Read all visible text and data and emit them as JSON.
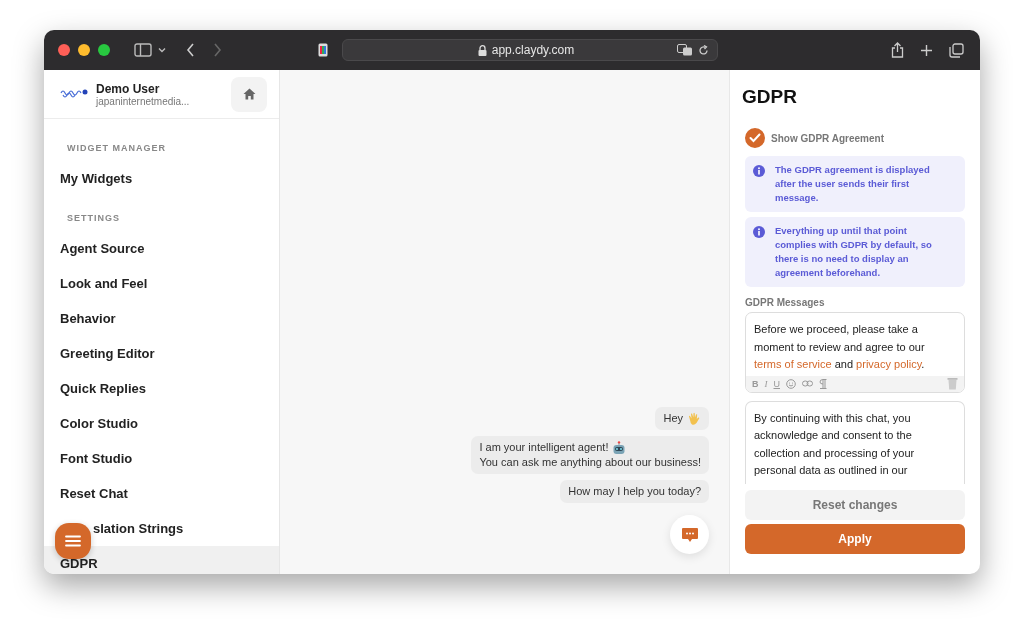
{
  "browser": {
    "url": "app.claydy.com"
  },
  "user": {
    "name": "Demo User",
    "email": "japaninternetmedia..."
  },
  "sidebar": {
    "sections": [
      {
        "heading": "WIDGET MANAGER",
        "items": [
          {
            "label": "My Widgets",
            "selected": false,
            "kind": "plain"
          }
        ]
      },
      {
        "heading": "SETTINGS",
        "items": [
          {
            "label": "Agent Source",
            "selected": false,
            "kind": "plain"
          },
          {
            "label": "Look and Feel",
            "selected": false,
            "kind": "plain"
          },
          {
            "label": "Behavior",
            "selected": false,
            "kind": "plain"
          },
          {
            "label": "Greeting Editor",
            "selected": false,
            "kind": "plain"
          },
          {
            "label": "Quick Replies",
            "selected": false,
            "kind": "plain"
          },
          {
            "label": "Color Studio",
            "selected": false,
            "kind": "plain"
          },
          {
            "label": "Font Studio",
            "selected": false,
            "kind": "plain"
          },
          {
            "label": "Reset Chat",
            "selected": false,
            "kind": "plain"
          },
          {
            "label": "slation Strings",
            "selected": false,
            "kind": "overlapped"
          },
          {
            "label": "GDPR",
            "selected": true,
            "kind": "plain"
          }
        ]
      }
    ]
  },
  "chat": {
    "messages": [
      {
        "lines": [
          {
            "text": "Hey",
            "kind": "wave"
          }
        ]
      },
      {
        "lines": [
          {
            "text": "I am your intelligent agent!",
            "kind": "robot"
          },
          {
            "text": "You can ask me anything about our business!"
          }
        ]
      },
      {
        "lines": [
          {
            "text": "How may I help you today?"
          }
        ]
      }
    ]
  },
  "panel": {
    "title": "GDPR",
    "show_agreement": {
      "label": "Show GDPR Agreement",
      "checked": true
    },
    "notes": [
      "The GDPR agreement is displayed after the user sends their first message.",
      "Everything up until that point complies with GDPR by default, so there is no need to display an agreement beforehand."
    ],
    "messages_label": "GDPR Messages",
    "messages": [
      {
        "parts": [
          {
            "kind": "text",
            "text": "Before we proceed, please take a moment to review and agree to our "
          },
          {
            "kind": "link",
            "text": "terms of service"
          },
          {
            "kind": "text",
            "text": " and "
          },
          {
            "kind": "link",
            "text": "privacy policy"
          },
          {
            "kind": "text",
            "text": "."
          }
        ],
        "toolbar": [
          "B",
          "I",
          "U"
        ]
      },
      {
        "parts": [
          {
            "kind": "text",
            "text": "By continuing with this chat, you acknowledge and consent to the collection and processing of your personal data as outlined in our"
          }
        ]
      }
    ],
    "buttons": [
      {
        "label": "Reset changes",
        "kind": "secondary"
      },
      {
        "label": "Apply",
        "kind": "primary"
      }
    ]
  }
}
